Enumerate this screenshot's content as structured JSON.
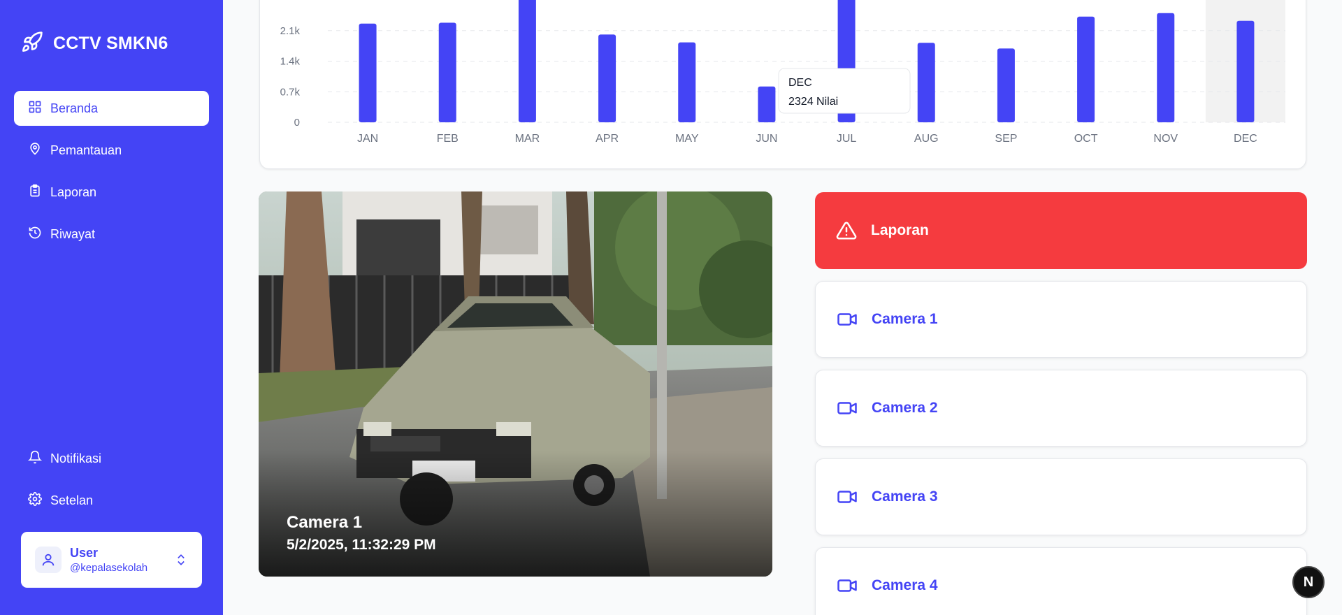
{
  "app": {
    "title": "CCTV SMKN6"
  },
  "sidebar": {
    "items": [
      {
        "label": "Beranda",
        "icon": "grid-icon",
        "active": true
      },
      {
        "label": "Pemantauan",
        "icon": "location-icon"
      },
      {
        "label": "Laporan",
        "icon": "clipboard-icon"
      },
      {
        "label": "Riwayat",
        "icon": "history-icon"
      }
    ],
    "bottom_items": [
      {
        "label": "Notifikasi",
        "icon": "bell-icon"
      },
      {
        "label": "Setelan",
        "icon": "gear-icon"
      }
    ],
    "user": {
      "name": "User",
      "handle": "@kepalasekolah"
    }
  },
  "chart_data": {
    "type": "bar",
    "categories": [
      "JAN",
      "FEB",
      "MAR",
      "APR",
      "MAY",
      "JUN",
      "JUL",
      "AUG",
      "SEP",
      "OCT",
      "NOV",
      "DEC"
    ],
    "values": [
      2260,
      2280,
      2900,
      2010,
      1830,
      820,
      2900,
      1820,
      1690,
      2420,
      2500,
      2324
    ],
    "y_ticks": [
      "0",
      "0.7k",
      "1.4k",
      "2.1k"
    ],
    "ylim": [
      0,
      2800
    ],
    "grid": true,
    "color": "#4444f5",
    "highlight_index": 11,
    "tooltip": {
      "label": "DEC",
      "value_text": "2324 Nilai"
    }
  },
  "feed": {
    "camera": "Camera 1",
    "timestamp": "5/2/2025, 11:32:29 PM"
  },
  "panel": {
    "report_label": "Laporan",
    "cameras": [
      "Camera 1",
      "Camera 2",
      "Camera 3",
      "Camera 4"
    ]
  },
  "badge": {
    "label": "N"
  },
  "colors": {
    "primary": "#4444f5",
    "danger": "#f53b3f"
  }
}
